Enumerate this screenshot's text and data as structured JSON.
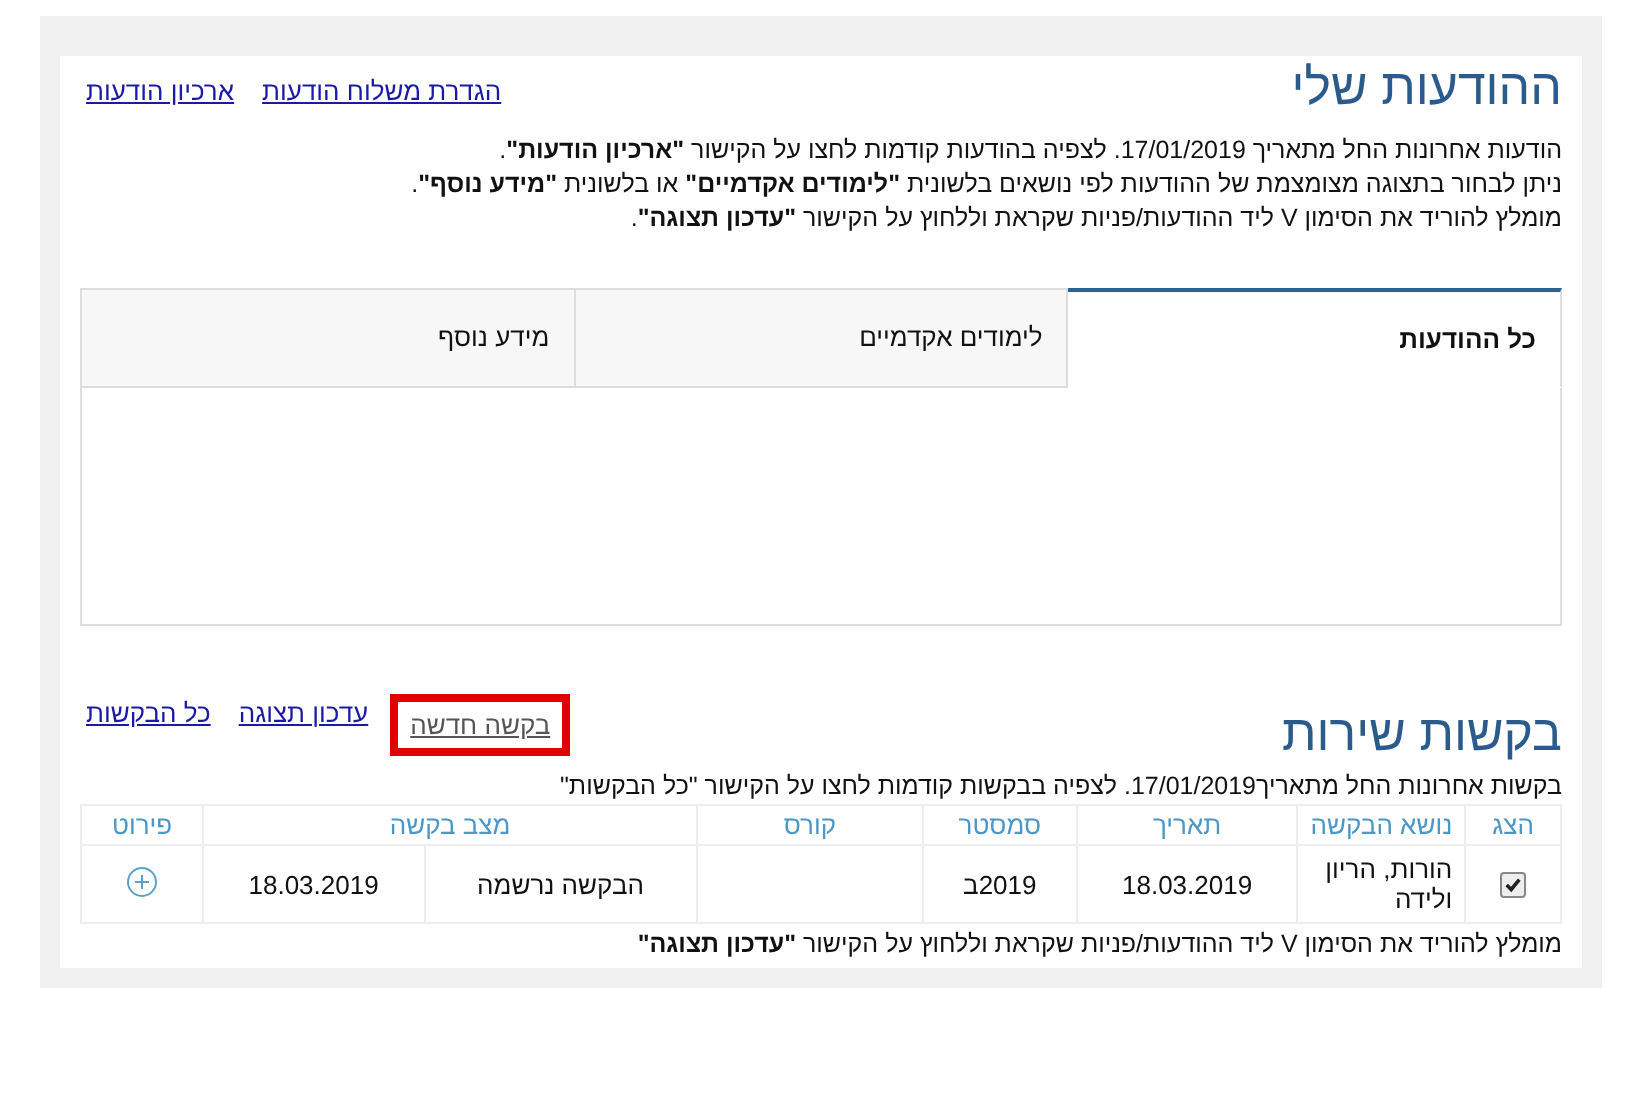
{
  "messages_section": {
    "title": "ההודעות שלי",
    "links": [
      {
        "label": "הגדרת משלוח הודעות",
        "highlighted": false
      },
      {
        "label": "ארכיון הודעות",
        "highlighted": false
      }
    ],
    "notes": [
      "הודעות אחרונות החל מתאריך 17/01/2019. לצפיה בהודעות קודמות לחצו על הקישור **\"ארכיון הודעות\"**.",
      "ניתן לבחור בתצוגה מצומצמת של ההודעות לפי נושאים בלשונית **\"לימודים אקדמיים\"** או בלשונית **\"מידע נוסף\"**.",
      "מומלץ להוריד את הסימון V ליד ההודעות/פניות שקראת וללחוץ על הקישור **\"עדכון תצוגה\"**."
    ],
    "tabs": [
      {
        "label": "כל ההודעות",
        "selected": true
      },
      {
        "label": "לימודים אקדמיים",
        "selected": false
      },
      {
        "label": "מידע נוסף",
        "selected": false
      }
    ]
  },
  "requests_section": {
    "title": "בקשות שירות",
    "links": [
      {
        "label": "בקשה חדשה",
        "highlighted": true
      },
      {
        "label": "עדכון תצוגה",
        "highlighted": false
      },
      {
        "label": "כל הבקשות",
        "highlighted": false
      }
    ],
    "note": "בקשות אחרונות החל מתאריך17/01/2019. לצפיה בבקשות קודמות לחצו על הקישור \"כל הבקשות\"",
    "table": {
      "columns": [
        "הצג",
        "נושא הבקשה",
        "תאריך",
        "סמסטר",
        "קורס",
        "מצב בקשה",
        "פירוט"
      ],
      "rows": [
        {
          "checked": true,
          "subject": "הורות, הריון ולידה",
          "date": "18.03.2019",
          "semester": "2019ב",
          "course": "",
          "status": "הבקשה נרשמה",
          "status_date": "18.03.2019"
        }
      ]
    },
    "footer_note": "מומלץ להוריד את הסימון V ליד ההודעות/פניות שקראת וללחוץ על הקישור **\"עדכון תצוגה\"**"
  }
}
